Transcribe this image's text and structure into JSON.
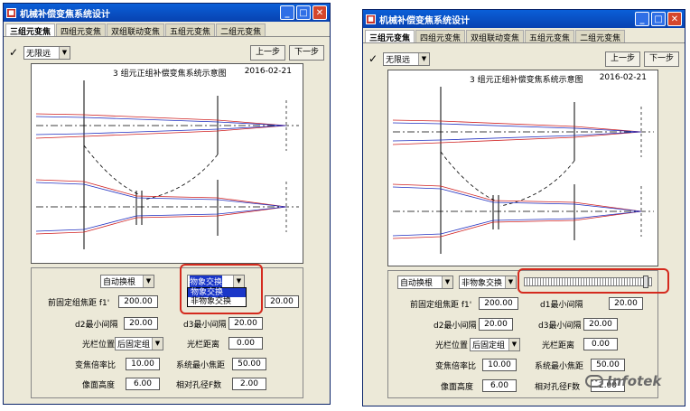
{
  "window": {
    "title": "机械补偿变焦系统设计"
  },
  "tabs": [
    "三组元变焦",
    "四组元变焦",
    "双组联动变焦",
    "五组元变焦",
    "二组元变焦"
  ],
  "toolbar": {
    "check": "✓",
    "mode": "无限远",
    "prev": "上一步",
    "next": "下一步"
  },
  "diagram": {
    "title": "3 组元正组补偿变焦系统示意图",
    "date": "2016-02-21"
  },
  "params": {
    "root_mode": "自动换根",
    "zoom_type_selected": "物象交换",
    "zoom_type_right": "非物象交换",
    "zoom_type_options": [
      "物象交换",
      "非物象交换"
    ],
    "front_focal_label": "前固定组焦距  f1'",
    "front_focal": "200.00",
    "d1_label": "d1最小间隔",
    "d1": "20.00",
    "d2_label": "d2最小间隔",
    "d2": "20.00",
    "d3_label": "d3最小间隔",
    "d3": "20.00",
    "stop_pos_label": "光栏位置",
    "stop_pos": "后固定组",
    "stop_dist_label": "光栏距离",
    "stop_dist": "0.00",
    "zoom_ratio_label": "变焦倍率比",
    "zoom_ratio": "10.00",
    "min_focal_label": "系统最小焦距",
    "min_focal": "50.00",
    "image_height_label": "像面高度",
    "image_height": "6.00",
    "rel_aperture_label": "相对孔径F数",
    "rel_aperture": "2.00"
  },
  "watermark": {
    "text": "Infotek"
  },
  "colors": {
    "title_bar": "#0842b0",
    "highlight": "#d42a1e",
    "ray_red": "#d02020",
    "ray_blue": "#2030c0"
  }
}
